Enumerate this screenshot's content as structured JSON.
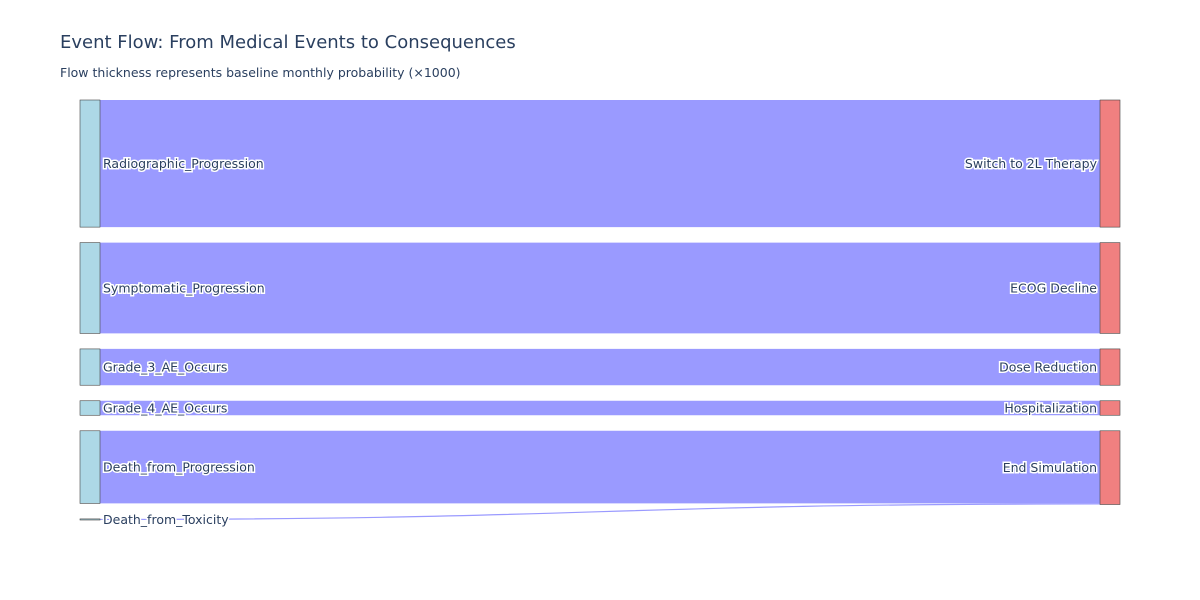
{
  "chart_data": {
    "type": "sankey",
    "title": "Event Flow: From Medical Events to Consequences",
    "subtitle": "Flow thickness represents baseline monthly probability (×1000)",
    "sources": [
      "Radiographic_Progression",
      "Symptomatic_Progression",
      "Grade_3_AE_Occurs",
      "Grade_4_AE_Occurs",
      "Death_from_Progression",
      "Death_from_Toxicity"
    ],
    "targets": [
      "Switch to 2L Therapy",
      "ECOG Decline",
      "Dose Reduction",
      "Hospitalization",
      "End Simulation"
    ],
    "links": [
      {
        "source": "Radiographic_Progression",
        "target": "Switch to 2L Therapy",
        "value": 35
      },
      {
        "source": "Symptomatic_Progression",
        "target": "ECOG Decline",
        "value": 25
      },
      {
        "source": "Grade_3_AE_Occurs",
        "target": "Dose Reduction",
        "value": 10
      },
      {
        "source": "Grade_4_AE_Occurs",
        "target": "Hospitalization",
        "value": 4
      },
      {
        "source": "Death_from_Progression",
        "target": "End Simulation",
        "value": 20
      },
      {
        "source": "Death_from_Toxicity",
        "target": "End Simulation",
        "value": 0.3
      }
    ],
    "colors": {
      "source_node": "#add8e6",
      "target_node": "#f08080",
      "link": "#9a9aff",
      "node_border": "#444444"
    }
  }
}
